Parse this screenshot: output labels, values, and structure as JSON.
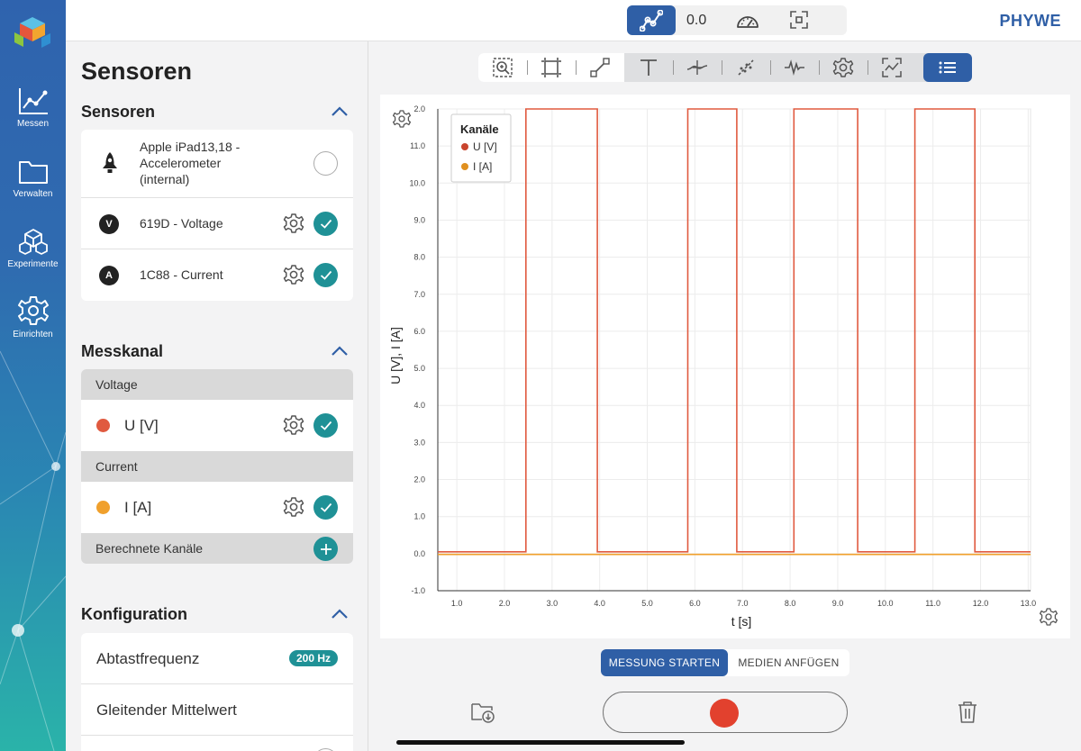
{
  "topbar": {
    "value_display": "0.0",
    "brand": "PHYWE"
  },
  "nav": [
    {
      "label": "Messen",
      "icon": "chart-icon"
    },
    {
      "label": "Verwalten",
      "icon": "folder-icon"
    },
    {
      "label": "Experimente",
      "icon": "cubes-icon"
    },
    {
      "label": "Einrichten",
      "icon": "gear-icon"
    }
  ],
  "panel": {
    "title": "Sensoren",
    "sensors": {
      "title": "Sensoren",
      "items": [
        {
          "label_lines": [
            "Apple iPad13,18 -",
            "Accelerometer",
            "(internal)"
          ],
          "icon": "rocket-icon",
          "selected": false
        },
        {
          "label": "619D - Voltage",
          "icon_letter": "V",
          "selected": true
        },
        {
          "label": "1C88 - Current",
          "icon_letter": "A",
          "selected": true
        }
      ]
    },
    "messkanal": {
      "title": "Messkanal",
      "groups": [
        {
          "header": "Voltage",
          "channel": "U [V]",
          "color": "#e05a3f"
        },
        {
          "header": "Current",
          "channel": "I [A]",
          "color": "#f0a02c"
        }
      ],
      "computed_header": "Berechnete Kanäle"
    },
    "konfiguration": {
      "title": "Konfiguration",
      "rows": [
        {
          "label": "Abtastfrequenz",
          "badge": "200 Hz"
        },
        {
          "label": "Gleitender Mittelwert"
        }
      ]
    }
  },
  "actions": {
    "start_label": "MESSUNG STARTEN",
    "media_label": "MEDIEN ANFÜGEN"
  },
  "chart_data": {
    "type": "line",
    "xlabel": "t [s]",
    "ylabel": "U [V], I [A]",
    "xlim": [
      0.6,
      13.05
    ],
    "ylim": [
      -1.0,
      12.0
    ],
    "x_ticks": [
      "1.0",
      "2.0",
      "3.0",
      "4.0",
      "5.0",
      "6.0",
      "7.0",
      "8.0",
      "9.0",
      "10.0",
      "11.0",
      "12.0",
      "13.0"
    ],
    "y_ticks": [
      "-1.0",
      "0.0",
      "1.0",
      "2.0",
      "3.0",
      "4.0",
      "5.0",
      "6.0",
      "7.0",
      "8.0",
      "9.0",
      "10.0",
      "11.0",
      "2.0"
    ],
    "grid": true,
    "legend": {
      "title": "Kanäle",
      "position": "top-left"
    },
    "series": [
      {
        "name": "U [V]",
        "color": "#e05a3f",
        "x": [
          0.6,
          2.45,
          2.45,
          3.95,
          3.95,
          5.85,
          5.85,
          6.88,
          6.88,
          8.08,
          8.08,
          9.42,
          9.42,
          10.62,
          10.62,
          11.88,
          11.88,
          13.05
        ],
        "y": [
          0.05,
          0.05,
          12.0,
          12.0,
          0.05,
          0.05,
          12.0,
          12.0,
          0.05,
          0.05,
          12.0,
          12.0,
          0.05,
          0.05,
          12.0,
          12.0,
          0.05,
          0.05
        ]
      },
      {
        "name": "I [A]",
        "color": "#f0a02c",
        "x": [
          0.6,
          13.05
        ],
        "y": [
          -0.02,
          -0.02
        ]
      }
    ]
  }
}
